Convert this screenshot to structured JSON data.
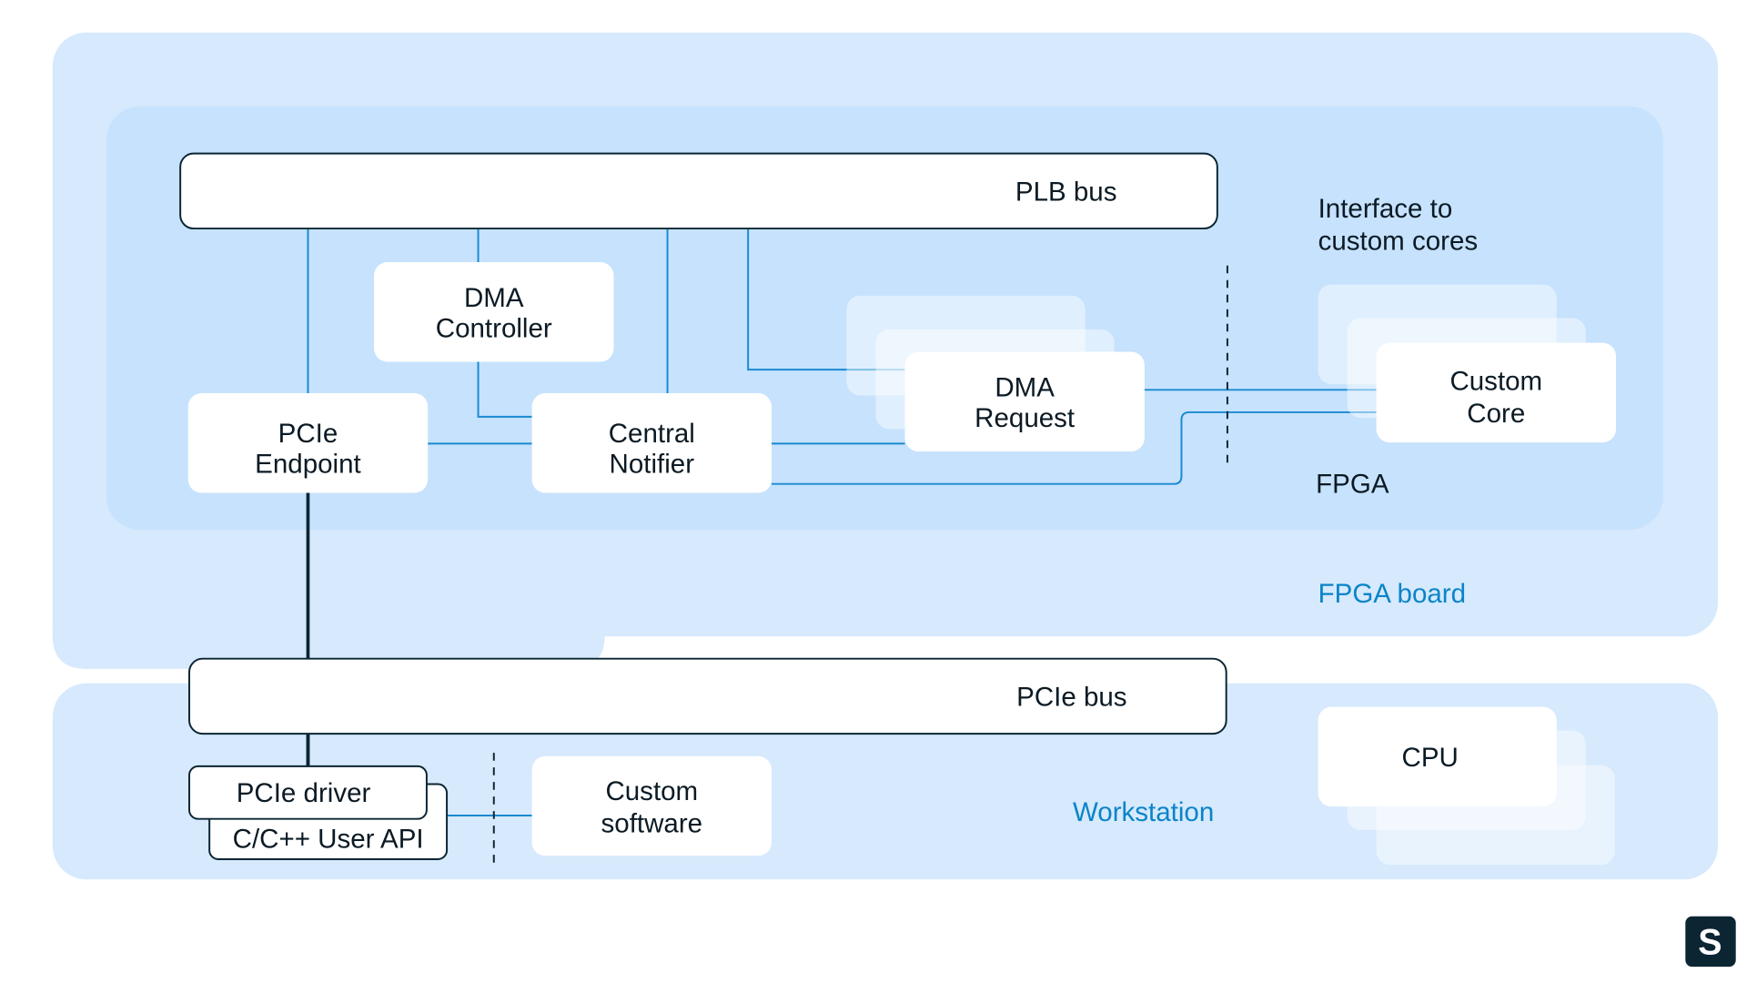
{
  "labels": {
    "plb_bus": "PLB bus",
    "dma_controller": [
      "DMA",
      "Controller"
    ],
    "pcie_endpoint": [
      "PCIe",
      "Endpoint"
    ],
    "central_notifier": [
      "Central",
      "Notifier"
    ],
    "dma_request": [
      "DMA",
      "Request"
    ],
    "interface": [
      "Interface to",
      "custom cores"
    ],
    "custom_core": [
      "Custom",
      "Core"
    ],
    "fpga": "FPGA",
    "fpga_board": "FPGA board",
    "pcie_bus": "PCIe bus",
    "pcie_driver": "PCIe driver",
    "user_api": "C/C++ User API",
    "custom_software": [
      "Custom",
      "software"
    ],
    "workstation": "Workstation",
    "cpu": "CPU",
    "logo": "S"
  },
  "colors": {
    "board": "#d6e9fd",
    "fpga": "#c7e2fd",
    "line": "#1a8ad0",
    "dark": "#0b2533",
    "accent_text": "#0a84c8"
  }
}
